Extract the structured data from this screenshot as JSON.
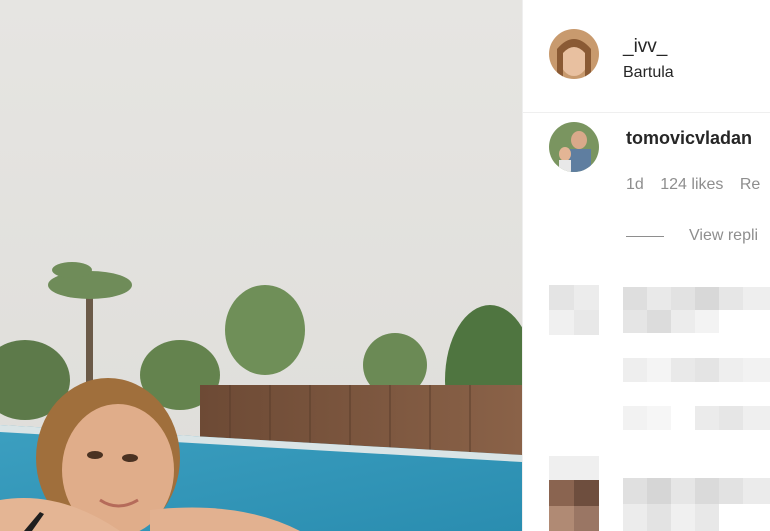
{
  "post": {
    "author_username": "_ivv_",
    "location": "Bartula"
  },
  "comment": {
    "username": "tomovicvladan",
    "time": "1d",
    "likes": "124 likes",
    "reply_label": "Re",
    "view_replies": "View repli"
  },
  "icons": {
    "author_avatar": "profile-photo-icon",
    "commenter_avatar": "profile-photo-icon"
  },
  "colors": {
    "text_primary": "#262626",
    "text_secondary": "#8e8e8e",
    "divider": "#efefef"
  }
}
